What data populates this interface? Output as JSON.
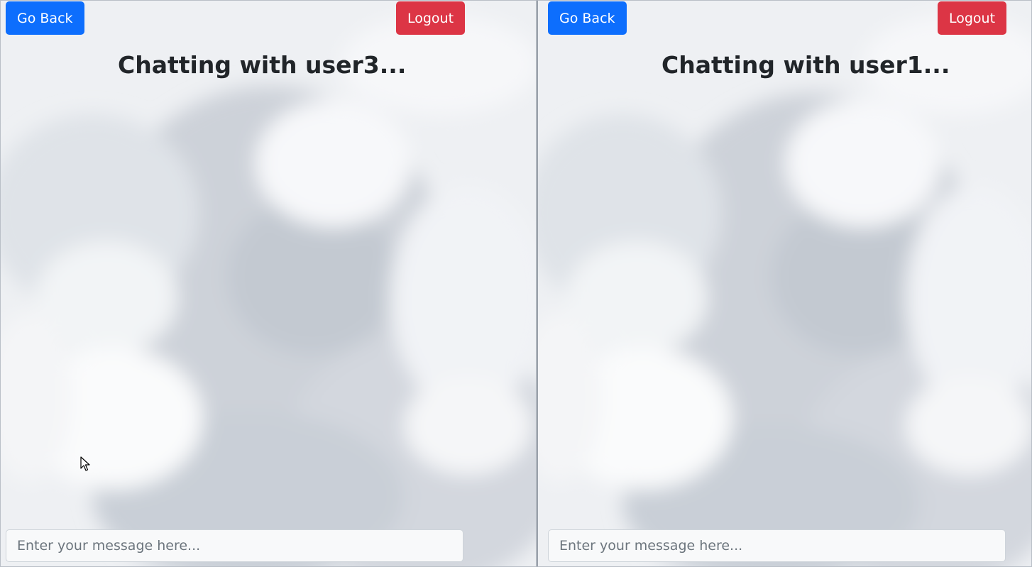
{
  "panes": [
    {
      "go_back_label": "Go Back",
      "logout_label": "Logout",
      "title": "Chatting with user3...",
      "message_placeholder": "Enter your message here..."
    },
    {
      "go_back_label": "Go Back",
      "logout_label": "Logout",
      "title": "Chatting with user1...",
      "message_placeholder": "Enter your message here..."
    }
  ],
  "colors": {
    "primary": "#0d6efd",
    "danger": "#dc3545",
    "text": "#212529",
    "background": "#f7f8fa"
  },
  "icons": [
    "mouse-pointer-icon"
  ]
}
